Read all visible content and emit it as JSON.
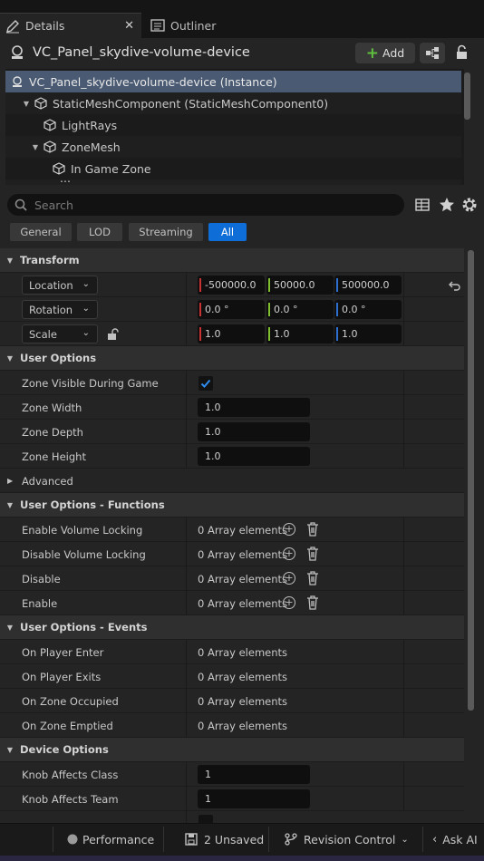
{
  "tabs": {
    "details": "Details",
    "outliner": "Outliner"
  },
  "actor": {
    "name": "VC_Panel_skydive-volume-device",
    "add_label": "Add"
  },
  "tree": [
    {
      "label": "VC_Panel_skydive-volume-device (Instance)"
    },
    {
      "label": "StaticMeshComponent (StaticMeshComponent0)"
    },
    {
      "label": "LightRays"
    },
    {
      "label": "ZoneMesh"
    },
    {
      "label": "In Game Zone"
    },
    {
      "label": "..."
    }
  ],
  "search": {
    "placeholder": "Search"
  },
  "filters": [
    "General",
    "LOD",
    "Streaming",
    "All"
  ],
  "categories": {
    "transform": "Transform",
    "user_options": "User Options",
    "advanced": "Advanced",
    "functions": "User Options - Functions",
    "events": "User Options - Events",
    "device": "Device Options"
  },
  "transform": {
    "location": {
      "label": "Location",
      "x": "-500000.0",
      "y": "50000.0",
      "z": "500000.0"
    },
    "rotation": {
      "label": "Rotation",
      "x": "0.0 °",
      "y": "0.0 °",
      "z": "0.0 °"
    },
    "scale": {
      "label": "Scale",
      "x": "1.0",
      "y": "1.0",
      "z": "1.0"
    }
  },
  "user_options": {
    "visible_label": "Zone Visible During Game",
    "visible_checked": true,
    "width_label": "Zone Width",
    "width": "1.0",
    "depth_label": "Zone Depth",
    "depth": "1.0",
    "height_label": "Zone Height",
    "height": "1.0"
  },
  "functions": [
    {
      "label": "Enable Volume Locking",
      "value": "0 Array elements"
    },
    {
      "label": "Disable Volume Locking",
      "value": "0 Array elements"
    },
    {
      "label": "Disable",
      "value": "0 Array elements"
    },
    {
      "label": "Enable",
      "value": "0 Array elements"
    }
  ],
  "events": [
    {
      "label": "On Player Enter",
      "value": "0 Array elements"
    },
    {
      "label": "On Player Exits",
      "value": "0 Array elements"
    },
    {
      "label": "On Zone Occupied",
      "value": "0 Array elements"
    },
    {
      "label": "On Zone Emptied",
      "value": "0 Array elements"
    }
  ],
  "device": [
    {
      "label": "Knob Affects Class",
      "value": "1"
    },
    {
      "label": "Knob Affects Team",
      "value": "1"
    }
  ],
  "statusbar": {
    "performance": "Performance",
    "unsaved": "2 Unsaved",
    "revision": "Revision Control",
    "askai": "Ask AI"
  },
  "colors": {
    "accent": "#0f6dd8",
    "x_axis": "#c83232",
    "y_axis": "#7fbf2f",
    "z_axis": "#2f6fd0",
    "selection": "#4a5a73"
  }
}
